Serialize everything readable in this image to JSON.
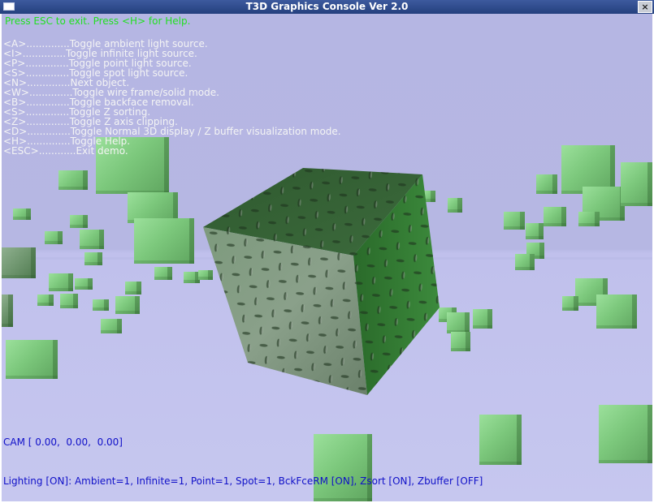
{
  "window": {
    "title": "T3D Graphics Console Ver 2.0",
    "close_glyph": "×"
  },
  "hud": {
    "help_line": "Press ESC to exit. Press <H> for Help.",
    "menu": [
      "<A>..............Toggle ambient light source.",
      "<I>..............Toggle infinite light source.",
      "<P>..............Toggle point light source.",
      "<S>..............Toggle spot light source.",
      "<N>..............Next object.",
      "<W>..............Toggle wire frame/solid mode.",
      "<B>..............Toggle backface removal.",
      "<S>..............Toggle Z sorting.",
      "<Z>..............Toggle Z axis clipping.",
      "<D>..............Toggle Normal 3D display / Z buffer visualization mode.",
      "<H>..............Toggle Help.",
      "<ESC>............Exit demo."
    ],
    "cam": "CAM [ 0.00,  0.00,  0.00]",
    "status": "Lighting [ON]: Ambient=1, Infinite=1, Point=1, Spot=1, BckFceRM [ON], Zsort [ON], Zbuffer [OFF]"
  },
  "colors": {
    "help_text": "#22e022",
    "menu_text": "#f4f4f4",
    "status_text": "#1010c8",
    "sky": "#b5b6e3",
    "floor": "#c6c7ef"
  },
  "icons": {
    "system_menu": "window-icon",
    "close": "close-icon",
    "main_object": "textured-cube"
  }
}
